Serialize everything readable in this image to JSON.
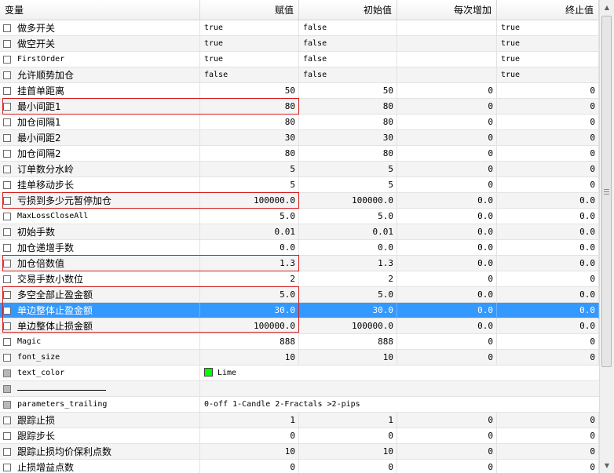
{
  "columns": {
    "variable": "变量",
    "value": "赋值",
    "start": "初始值",
    "step": "每次增加",
    "stop": "终止值"
  },
  "rows": [
    {
      "name": "做多开关",
      "kind": "text",
      "value": "true",
      "start": "false",
      "step": "",
      "stop": "true"
    },
    {
      "name": "做空开关",
      "kind": "text",
      "value": "true",
      "start": "false",
      "step": "",
      "stop": "true"
    },
    {
      "name": "FirstOrder",
      "kind": "text",
      "latin": true,
      "value": "true",
      "start": "false",
      "step": "",
      "stop": "true"
    },
    {
      "name": "允许顺势加仓",
      "kind": "text",
      "value": "false",
      "start": "false",
      "step": "",
      "stop": "true"
    },
    {
      "name": "挂首单距离",
      "kind": "num",
      "value": "50",
      "start": "50",
      "step": "0",
      "stop": "0"
    },
    {
      "name": "最小间距1",
      "kind": "num",
      "value": "80",
      "start": "80",
      "step": "0",
      "stop": "0"
    },
    {
      "name": "加仓间隔1",
      "kind": "num",
      "value": "80",
      "start": "80",
      "step": "0",
      "stop": "0"
    },
    {
      "name": "最小间距2",
      "kind": "num",
      "value": "30",
      "start": "30",
      "step": "0",
      "stop": "0"
    },
    {
      "name": "加仓间隔2",
      "kind": "num",
      "value": "80",
      "start": "80",
      "step": "0",
      "stop": "0"
    },
    {
      "name": "订单数分水岭",
      "kind": "num",
      "value": "5",
      "start": "5",
      "step": "0",
      "stop": "0"
    },
    {
      "name": "挂单移动步长",
      "kind": "num",
      "value": "5",
      "start": "5",
      "step": "0",
      "stop": "0"
    },
    {
      "name": "亏损到多少元暂停加仓",
      "kind": "num",
      "value": "100000.0",
      "start": "100000.0",
      "step": "0.0",
      "stop": "0.0"
    },
    {
      "name": "MaxLossCloseAll",
      "kind": "num",
      "latin": true,
      "value": "5.0",
      "start": "5.0",
      "step": "0.0",
      "stop": "0.0"
    },
    {
      "name": "初始手数",
      "kind": "num",
      "value": "0.01",
      "start": "0.01",
      "step": "0.0",
      "stop": "0.0"
    },
    {
      "name": "加仓递增手数",
      "kind": "num",
      "value": "0.0",
      "start": "0.0",
      "step": "0.0",
      "stop": "0.0"
    },
    {
      "name": "加仓倍数值",
      "kind": "num",
      "value": "1.3",
      "start": "1.3",
      "step": "0.0",
      "stop": "0.0"
    },
    {
      "name": "交易手数小数位",
      "kind": "num",
      "value": "2",
      "start": "2",
      "step": "0",
      "stop": "0"
    },
    {
      "name": "多空全部止盈金额",
      "kind": "num",
      "value": "5.0",
      "start": "5.0",
      "step": "0.0",
      "stop": "0.0"
    },
    {
      "name": "单边整体止盈金额",
      "kind": "num",
      "value": "30.0",
      "start": "30.0",
      "step": "0.0",
      "stop": "0.0",
      "selected": true
    },
    {
      "name": "单边整体止损金额",
      "kind": "num",
      "value": "100000.0",
      "start": "100000.0",
      "step": "0.0",
      "stop": "0.0"
    },
    {
      "name": "Magic",
      "kind": "num",
      "latin": true,
      "value": "888",
      "start": "888",
      "step": "0",
      "stop": "0"
    },
    {
      "name": "font_size",
      "kind": "num",
      "latin": true,
      "value": "10",
      "start": "10",
      "step": "0",
      "stop": "0"
    },
    {
      "name": "text_color",
      "kind": "color",
      "latin": true,
      "disabled": true,
      "value": "Lime",
      "color": "#00ff00"
    },
    {
      "name": "________________",
      "kind": "separator",
      "disabled": true
    },
    {
      "name": "parameters_trailing",
      "kind": "span",
      "latin": true,
      "disabled": true,
      "value": "0-off  1-Candle  2-Fractals  >2-pips"
    },
    {
      "name": "跟踪止损",
      "kind": "num",
      "value": "1",
      "start": "1",
      "step": "0",
      "stop": "0"
    },
    {
      "name": "跟踪步长",
      "kind": "num",
      "value": "0",
      "start": "0",
      "step": "0",
      "stop": "0"
    },
    {
      "name": "跟踪止损均价保利点数",
      "kind": "num",
      "value": "10",
      "start": "10",
      "step": "0",
      "stop": "0"
    },
    {
      "name": "止损增益点数",
      "kind": "num",
      "value": "0",
      "start": "0",
      "step": "0",
      "stop": "0"
    }
  ],
  "colors": {
    "selection": "#3399ff",
    "highlight_border": "#d21e1e"
  },
  "scrollbar": {
    "up_icon": "arrow-up-icon",
    "down_icon": "arrow-down-icon"
  }
}
